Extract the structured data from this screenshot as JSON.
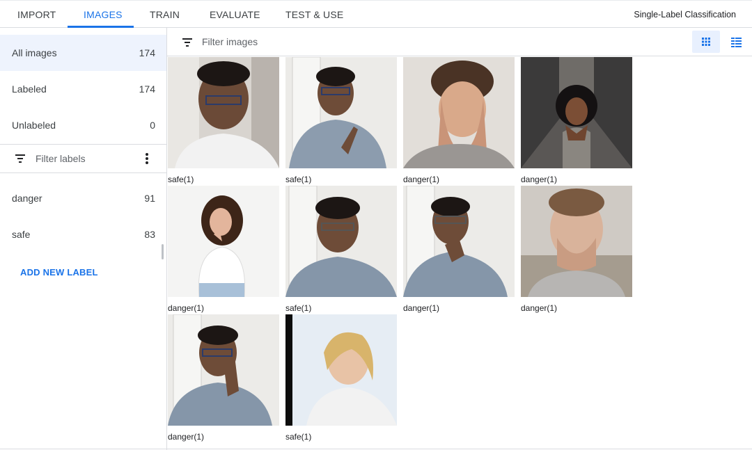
{
  "tabs": [
    {
      "label": "IMPORT"
    },
    {
      "label": "IMAGES"
    },
    {
      "label": "TRAIN"
    },
    {
      "label": "EVALUATE"
    },
    {
      "label": "TEST & USE"
    }
  ],
  "active_tab": "IMAGES",
  "mode_label": "Single-Label Classification",
  "sidebar": {
    "filters": [
      {
        "label": "All images",
        "count": "174"
      },
      {
        "label": "Labeled",
        "count": "174"
      },
      {
        "label": "Unlabeled",
        "count": "0"
      }
    ],
    "filter_labels_placeholder": "Filter labels",
    "labels": [
      {
        "label": "danger",
        "count": "91"
      },
      {
        "label": "safe",
        "count": "83"
      }
    ],
    "add_label": "ADD NEW LABEL"
  },
  "toolbar": {
    "filter_images_placeholder": "Filter images"
  },
  "images": [
    {
      "caption": "safe(1)"
    },
    {
      "caption": "safe(1)"
    },
    {
      "caption": "danger(1)"
    },
    {
      "caption": "danger(1)"
    },
    {
      "caption": "danger(1)"
    },
    {
      "caption": "safe(1)"
    },
    {
      "caption": "danger(1)"
    },
    {
      "caption": "danger(1)"
    },
    {
      "caption": "danger(1)"
    },
    {
      "caption": "safe(1)"
    }
  ],
  "colors": {
    "accent": "#1a73e8",
    "selected_bg": "#eef3fd"
  }
}
